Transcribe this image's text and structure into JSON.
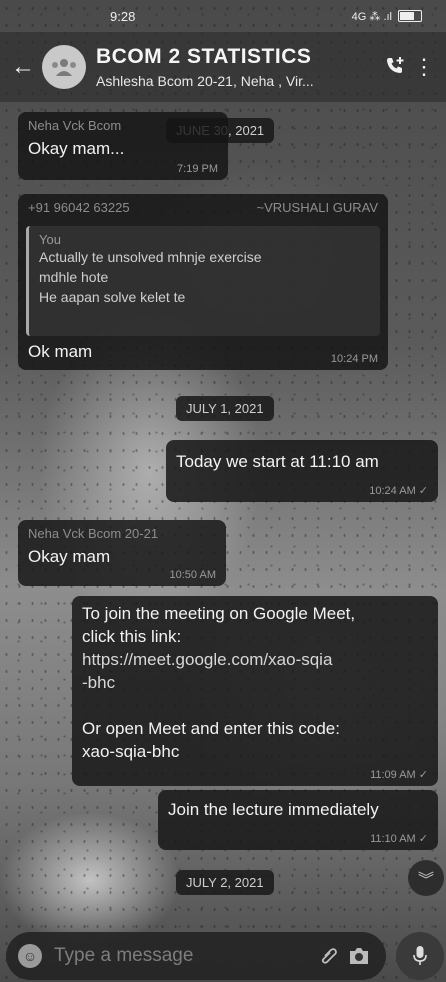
{
  "status_bar": {
    "time": "9:28",
    "network": "4G ⁂ .ıl",
    "battery": "74"
  },
  "header": {
    "back_icon": "arrow-left-icon",
    "title": "BCOM 2 STATISTICS",
    "subtitle": "Ashlesha Bcom 20-21, Neha , Vir...",
    "call_icon": "add-call-icon",
    "menu_icon": "more-vert-icon"
  },
  "messages": [
    {
      "type": "in",
      "sender": "Neha Vck Bcom",
      "text": "Okay mam...",
      "time": "7:19 PM"
    },
    {
      "type": "in",
      "sender": "+91 96042 63225",
      "sender_name": "~VRUSHALI GURAV",
      "quote_author": "You",
      "quote_lines": [
        "Actually te unsolved mhnje exercise",
        "mdhle hote",
        "He aapan solve kelet te"
      ],
      "text": "Ok mam",
      "time": "10:24 PM"
    },
    {
      "type": "out",
      "text": "Today we start at 11:10 am",
      "time": "10:24 AM ✓"
    },
    {
      "type": "in",
      "sender": "Neha Vck Bcom 20-21",
      "text": "Okay mam",
      "time": "10:50 AM"
    },
    {
      "type": "out",
      "lines": [
        "To join the meeting on Google Meet,",
        "click this link:",
        "https://meet.google.com/xao-sqia",
        "-bhc",
        "",
        "Or open Meet and enter this code:",
        "xao-sqia-bhc"
      ],
      "time": "11:09 AM ✓"
    },
    {
      "type": "out",
      "text": "Join the lecture immediately",
      "time": "11:10 AM ✓"
    }
  ],
  "date_chips": [
    "JUNE 30, 2021",
    "JULY 1, 2021",
    "JULY 2, 2021"
  ],
  "composer": {
    "placeholder": "Type a message",
    "emoji_icon": "emoji-icon",
    "attach_icon": "paperclip-icon",
    "camera_icon": "camera-icon",
    "mic_icon": "mic-icon"
  }
}
